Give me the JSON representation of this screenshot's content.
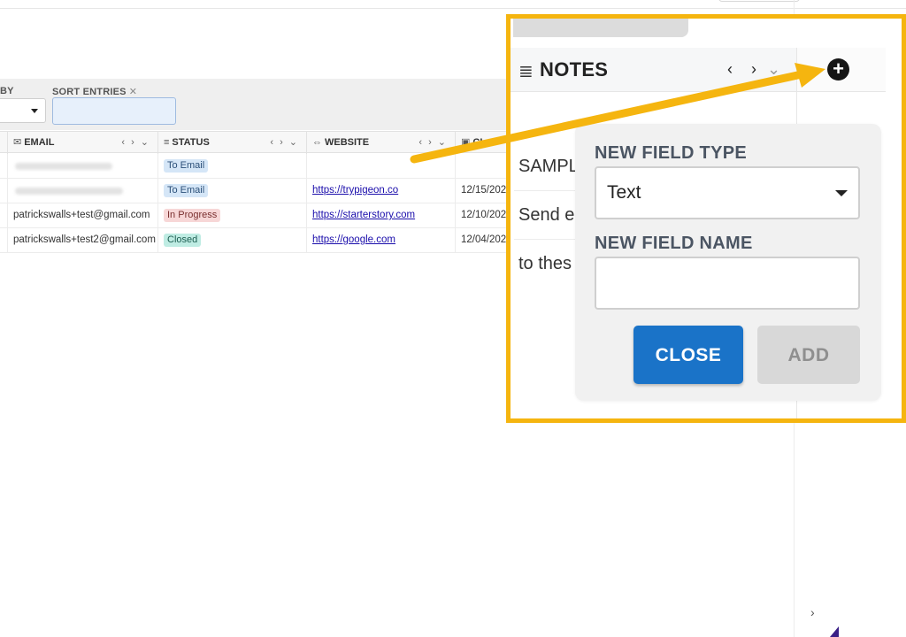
{
  "filters": {
    "group_by_label": "BY",
    "sort_label": "SORT ENTRIES",
    "sort_close_glyph": "✕"
  },
  "table": {
    "columns": [
      {
        "glyph": "✉",
        "label": "EMAIL",
        "controls": "‹ › ⌄"
      },
      {
        "glyph": "≡",
        "label": "STATUS",
        "controls": "‹ › ⌄"
      },
      {
        "glyph": "⇔",
        "label": "WEBSITE",
        "controls": "‹ › ⌄"
      },
      {
        "glyph": "▣",
        "label": "CL",
        "controls": ""
      }
    ],
    "rows": [
      {
        "email": "",
        "status": "To Email",
        "status_color": "blue",
        "website": "",
        "date": ""
      },
      {
        "email": "",
        "status": "To Email",
        "status_color": "blue",
        "website": "https://trypigeon.co",
        "date": "12/15/202"
      },
      {
        "email": "patrickswalls+test@gmail.com",
        "status": "In Progress",
        "status_color": "red",
        "website": "https://starterstory.com",
        "date": "12/10/202"
      },
      {
        "email": "patrickswalls+test2@gmail.com",
        "status": "Closed",
        "status_color": "teal",
        "website": "https://google.com",
        "date": "12/04/202"
      }
    ]
  },
  "notes_panel": {
    "title": "NOTES",
    "hamburger_glyph": "≣",
    "prev_next": "‹ ›",
    "collapse_glyph": "⌄",
    "add_field_glyph": "+",
    "lines": [
      "SAMPLE",
      "Send e",
      "to thes"
    ]
  },
  "new_field_popup": {
    "type_label": "NEW FIELD TYPE",
    "type_value": "Text",
    "name_label": "NEW FIELD NAME",
    "name_value": "",
    "close_label": "CLOSE",
    "add_label": "ADD"
  },
  "sidebar": {
    "expand_glyph": "›"
  },
  "colors": {
    "highlight": "#f5b50f",
    "primary_button": "#1a73c8",
    "disabled_button": "#d8d8d8"
  }
}
